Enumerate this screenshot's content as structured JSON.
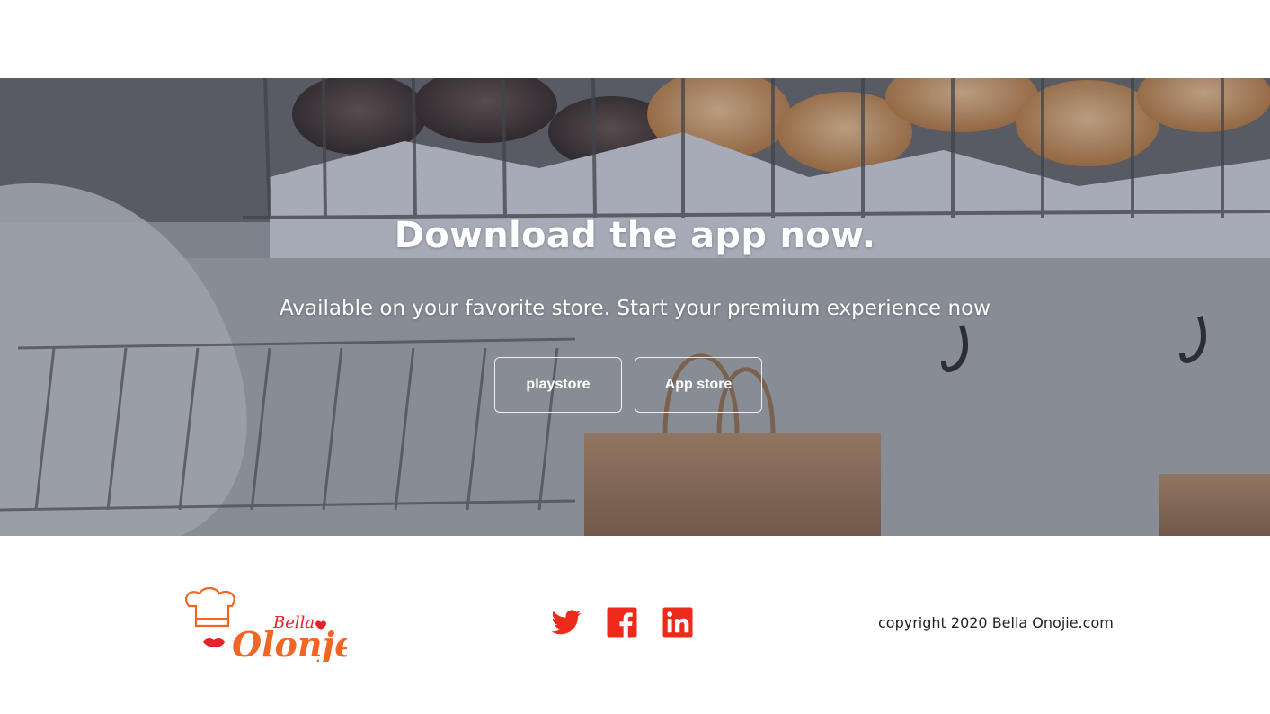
{
  "hero": {
    "title": "Download the app now.",
    "subtitle": "Available on your favorite store. Start your premium experience now",
    "buttons": {
      "playstore_label": "playstore",
      "appstore_label": "App store"
    }
  },
  "footer": {
    "logo": {
      "line1": "Bella",
      "line2": "Olonje"
    },
    "social": [
      {
        "icon": "twitter-icon"
      },
      {
        "icon": "facebook-icon"
      },
      {
        "icon": "linkedin-icon"
      }
    ],
    "copyright": "copyright 2020 Bella Onojie.com"
  },
  "colors": {
    "brand_orange": "#f26522",
    "brand_red": "#e8202a",
    "social_red": "#ee2a1b"
  }
}
